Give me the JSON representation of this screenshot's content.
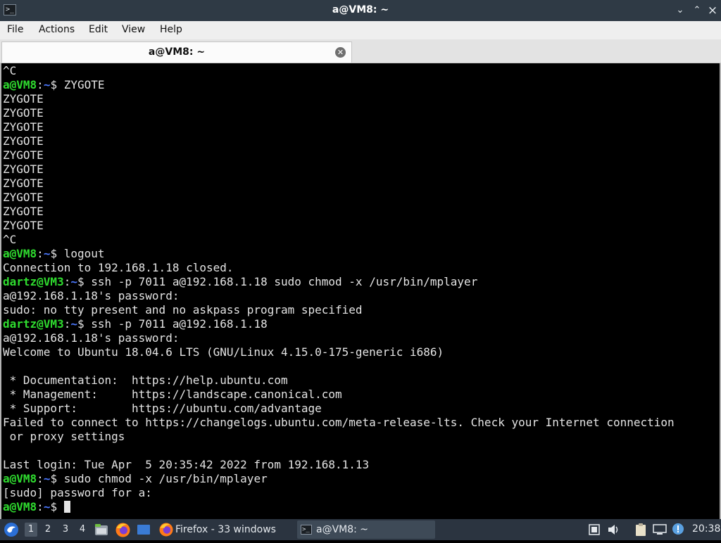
{
  "window": {
    "title": "a@VM8: ~",
    "controls": {
      "minimize": "⌄",
      "maximize": "⌃",
      "close": "×"
    }
  },
  "menu": [
    "File",
    "Actions",
    "Edit",
    "View",
    "Help"
  ],
  "tab": {
    "label": "a@VM8: ~"
  },
  "terminal": {
    "lines": [
      [
        {
          "t": "^C"
        }
      ],
      [
        {
          "t": "a@VM8",
          "c": "user"
        },
        {
          "t": ":"
        },
        {
          "t": "~",
          "c": "path"
        },
        {
          "t": "$ ZYGOTE"
        }
      ],
      [
        {
          "t": "ZYGOTE"
        }
      ],
      [
        {
          "t": "ZYGOTE"
        }
      ],
      [
        {
          "t": "ZYGOTE"
        }
      ],
      [
        {
          "t": "ZYGOTE"
        }
      ],
      [
        {
          "t": "ZYGOTE"
        }
      ],
      [
        {
          "t": "ZYGOTE"
        }
      ],
      [
        {
          "t": "ZYGOTE"
        }
      ],
      [
        {
          "t": "ZYGOTE"
        }
      ],
      [
        {
          "t": "ZYGOTE"
        }
      ],
      [
        {
          "t": "ZYGOTE"
        }
      ],
      [
        {
          "t": "^C"
        }
      ],
      [
        {
          "t": "a@VM8",
          "c": "user"
        },
        {
          "t": ":"
        },
        {
          "t": "~",
          "c": "path"
        },
        {
          "t": "$ logout"
        }
      ],
      [
        {
          "t": "Connection to 192.168.1.18 closed."
        }
      ],
      [
        {
          "t": "dartz@VM3",
          "c": "user"
        },
        {
          "t": ":"
        },
        {
          "t": "~",
          "c": "path"
        },
        {
          "t": "$ ssh -p 7011 a@192.168.1.18 sudo chmod -x /usr/bin/mplayer"
        }
      ],
      [
        {
          "t": "a@192.168.1.18's password:"
        }
      ],
      [
        {
          "t": "sudo: no tty present and no askpass program specified"
        }
      ],
      [
        {
          "t": "dartz@VM3",
          "c": "user"
        },
        {
          "t": ":"
        },
        {
          "t": "~",
          "c": "path"
        },
        {
          "t": "$ ssh -p 7011 a@192.168.1.18"
        }
      ],
      [
        {
          "t": "a@192.168.1.18's password:"
        }
      ],
      [
        {
          "t": "Welcome to Ubuntu 18.04.6 LTS (GNU/Linux 4.15.0-175-generic i686)"
        }
      ],
      [
        {
          "t": ""
        }
      ],
      [
        {
          "t": " * Documentation:  https://help.ubuntu.com"
        }
      ],
      [
        {
          "t": " * Management:     https://landscape.canonical.com"
        }
      ],
      [
        {
          "t": " * Support:        https://ubuntu.com/advantage"
        }
      ],
      [
        {
          "t": "Failed to connect to https://changelogs.ubuntu.com/meta-release-lts. Check your Internet connection"
        }
      ],
      [
        {
          "t": " or proxy settings"
        }
      ],
      [
        {
          "t": ""
        }
      ],
      [
        {
          "t": "Last login: Tue Apr  5 20:35:42 2022 from 192.168.1.13"
        }
      ],
      [
        {
          "t": "a@VM8",
          "c": "user"
        },
        {
          "t": ":"
        },
        {
          "t": "~",
          "c": "path"
        },
        {
          "t": "$ sudo chmod -x /usr/bin/mplayer"
        }
      ],
      [
        {
          "t": "[sudo] password for a:"
        }
      ],
      [
        {
          "t": "a@VM8",
          "c": "user"
        },
        {
          "t": ":"
        },
        {
          "t": "~",
          "c": "path"
        },
        {
          "t": "$ "
        }
      ]
    ],
    "colors": {
      "background": "#000000",
      "text": "#e4e4e4",
      "user": "#2fdc2f",
      "path": "#4b78ff"
    }
  },
  "taskbar": {
    "desktops": [
      "1",
      "2",
      "3",
      "4"
    ],
    "active_desktop": "1",
    "tasks": {
      "firefox": "Firefox - 33 windows",
      "terminal": "a@VM8: ~"
    },
    "clock": "20:38",
    "icons": [
      "start-menu-icon",
      "file-manager-icon",
      "firefox-icon",
      "show-desktop-icon",
      "volume-icon",
      "clipboard-icon",
      "network-icon",
      "update-notifier-icon"
    ]
  }
}
